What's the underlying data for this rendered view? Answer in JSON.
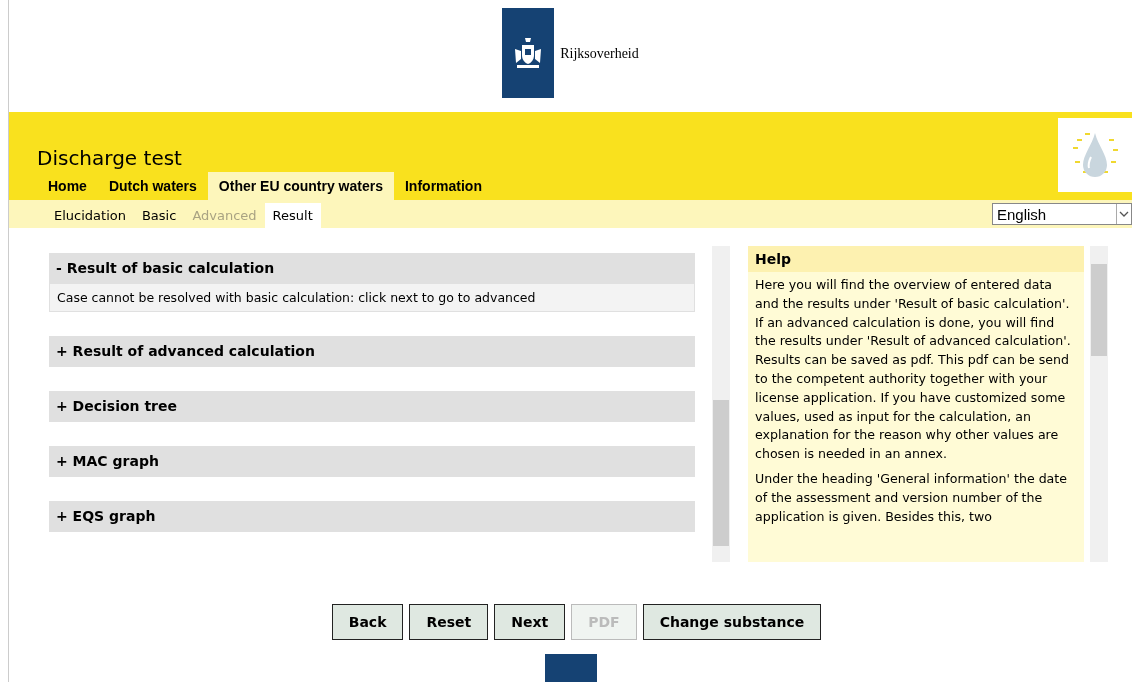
{
  "header": {
    "brand": "Rijksoverheid"
  },
  "app": {
    "title": "Discharge test"
  },
  "tabs": [
    {
      "label": "Home",
      "selected": false
    },
    {
      "label": "Dutch waters",
      "selected": false
    },
    {
      "label": "Other EU country waters",
      "selected": true
    },
    {
      "label": "Information",
      "selected": false
    }
  ],
  "subtabs": [
    {
      "label": "Elucidation",
      "selected": false,
      "disabled": false
    },
    {
      "label": "Basic",
      "selected": false,
      "disabled": false
    },
    {
      "label": "Advanced",
      "selected": false,
      "disabled": true
    },
    {
      "label": "Result",
      "selected": true,
      "disabled": false
    }
  ],
  "language": {
    "value": "English"
  },
  "sections": [
    {
      "toggle": "-",
      "title": "Result of basic calculation",
      "body": "Case cannot be resolved with basic calculation: click next to go to advanced"
    },
    {
      "toggle": "+",
      "title": "Result of advanced calculation"
    },
    {
      "toggle": "+",
      "title": "Decision tree"
    },
    {
      "toggle": "+",
      "title": "MAC graph"
    },
    {
      "toggle": "+",
      "title": "EQS graph"
    }
  ],
  "help": {
    "title": "Help",
    "paragraphs": [
      "Here you will find the overview of entered data and the results under 'Result of basic calculation'. If an advanced calculation is done, you will find the results under 'Result of advanced calculation'. Results can be saved as pdf. This pdf can be send to the competent authority together with your license application. If you have customized some values, used as input for the calculation, an explanation for the reason why other values are chosen is needed in an annex.",
      "Under the heading 'General information' the date of the assessment and version number of the application is given. Besides this, two"
    ]
  },
  "buttons": [
    {
      "label": "Back",
      "disabled": false
    },
    {
      "label": "Reset",
      "disabled": false
    },
    {
      "label": "Next",
      "disabled": false
    },
    {
      "label": "PDF",
      "disabled": true
    },
    {
      "label": "Change substance",
      "disabled": false
    }
  ]
}
